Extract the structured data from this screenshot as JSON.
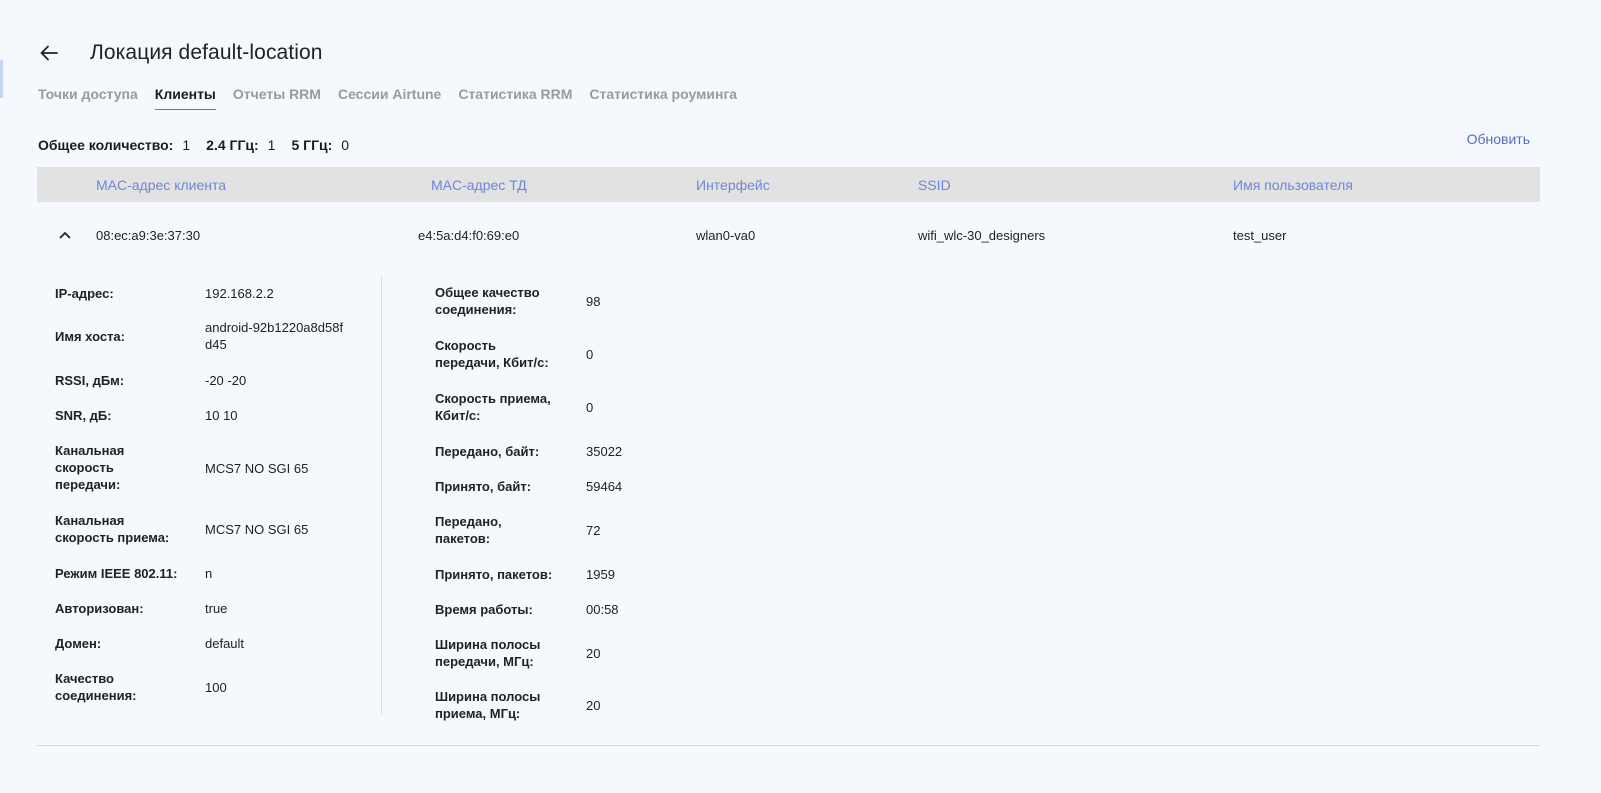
{
  "header": {
    "title": "Локация default-location"
  },
  "tabs": [
    {
      "label": "Точки доступа",
      "active": false
    },
    {
      "label": "Клиенты",
      "active": true
    },
    {
      "label": "Отчеты RRM",
      "active": false
    },
    {
      "label": "Сессии Airtune",
      "active": false
    },
    {
      "label": "Статистика RRM",
      "active": false
    },
    {
      "label": "Статистика роуминга",
      "active": false
    }
  ],
  "counts": {
    "total_label": "Общее количество:",
    "total_value": "1",
    "band24_label": "2.4 ГГц:",
    "band24_value": "1",
    "band5_label": "5 ГГц:",
    "band5_value": "0"
  },
  "toolbar": {
    "refresh_label": "Обновить"
  },
  "table": {
    "columns": [
      "MAC-адрес клиента",
      "MAC-адрес ТД",
      "Интерфейс",
      "SSID",
      "Имя пользователя"
    ],
    "rows": [
      {
        "client_mac": "08:ec:a9:3e:37:30",
        "ap_mac": "e4:5a:d4:f0:69:e0",
        "interface": "wlan0-va0",
        "ssid": "wifi_wlc-30_designers",
        "username": "test_user"
      }
    ]
  },
  "details": {
    "left": [
      {
        "label": "IP-адрес:",
        "value": "192.168.2.2"
      },
      {
        "label": "Имя хоста:",
        "value": "android-92b1220a8d58fd45"
      },
      {
        "label": "RSSI, дБм:",
        "value": "-20 -20"
      },
      {
        "label": "SNR, дБ:",
        "value": "10 10"
      },
      {
        "label": "Канальная скорость передачи:",
        "value": "MCS7 NO SGI 65"
      },
      {
        "label": "Канальная скорость приема:",
        "value": "MCS7 NO SGI 65"
      },
      {
        "label": "Режим IEEE 802.11:",
        "value": "n"
      },
      {
        "label": "Авторизован:",
        "value": "true"
      },
      {
        "label": "Домен:",
        "value": "default"
      },
      {
        "label": "Качество соединения:",
        "value": "100"
      }
    ],
    "right": [
      {
        "label": "Общее качество соединения:",
        "value": "98"
      },
      {
        "label": "Скорость передачи, Кбит/с:",
        "value": "0"
      },
      {
        "label": "Скорость приема, Кбит/с:",
        "value": "0"
      },
      {
        "label": "Передано, байт:",
        "value": "35022"
      },
      {
        "label": "Принято, байт:",
        "value": "59464"
      },
      {
        "label": "Передано, пакетов:",
        "value": "72"
      },
      {
        "label": "Принято, пакетов:",
        "value": "1959"
      },
      {
        "label": "Время работы:",
        "value": "00:58"
      },
      {
        "label": "Ширина полосы передачи, МГц:",
        "value": "20"
      },
      {
        "label": "Ширина полосы приема, МГц:",
        "value": "20"
      }
    ]
  },
  "colors": {
    "accent": "#4f6ec4",
    "column_header_text": "#6f86d8",
    "header_bg": "#e2e2e2",
    "page_bg": "#f5f8fd"
  }
}
